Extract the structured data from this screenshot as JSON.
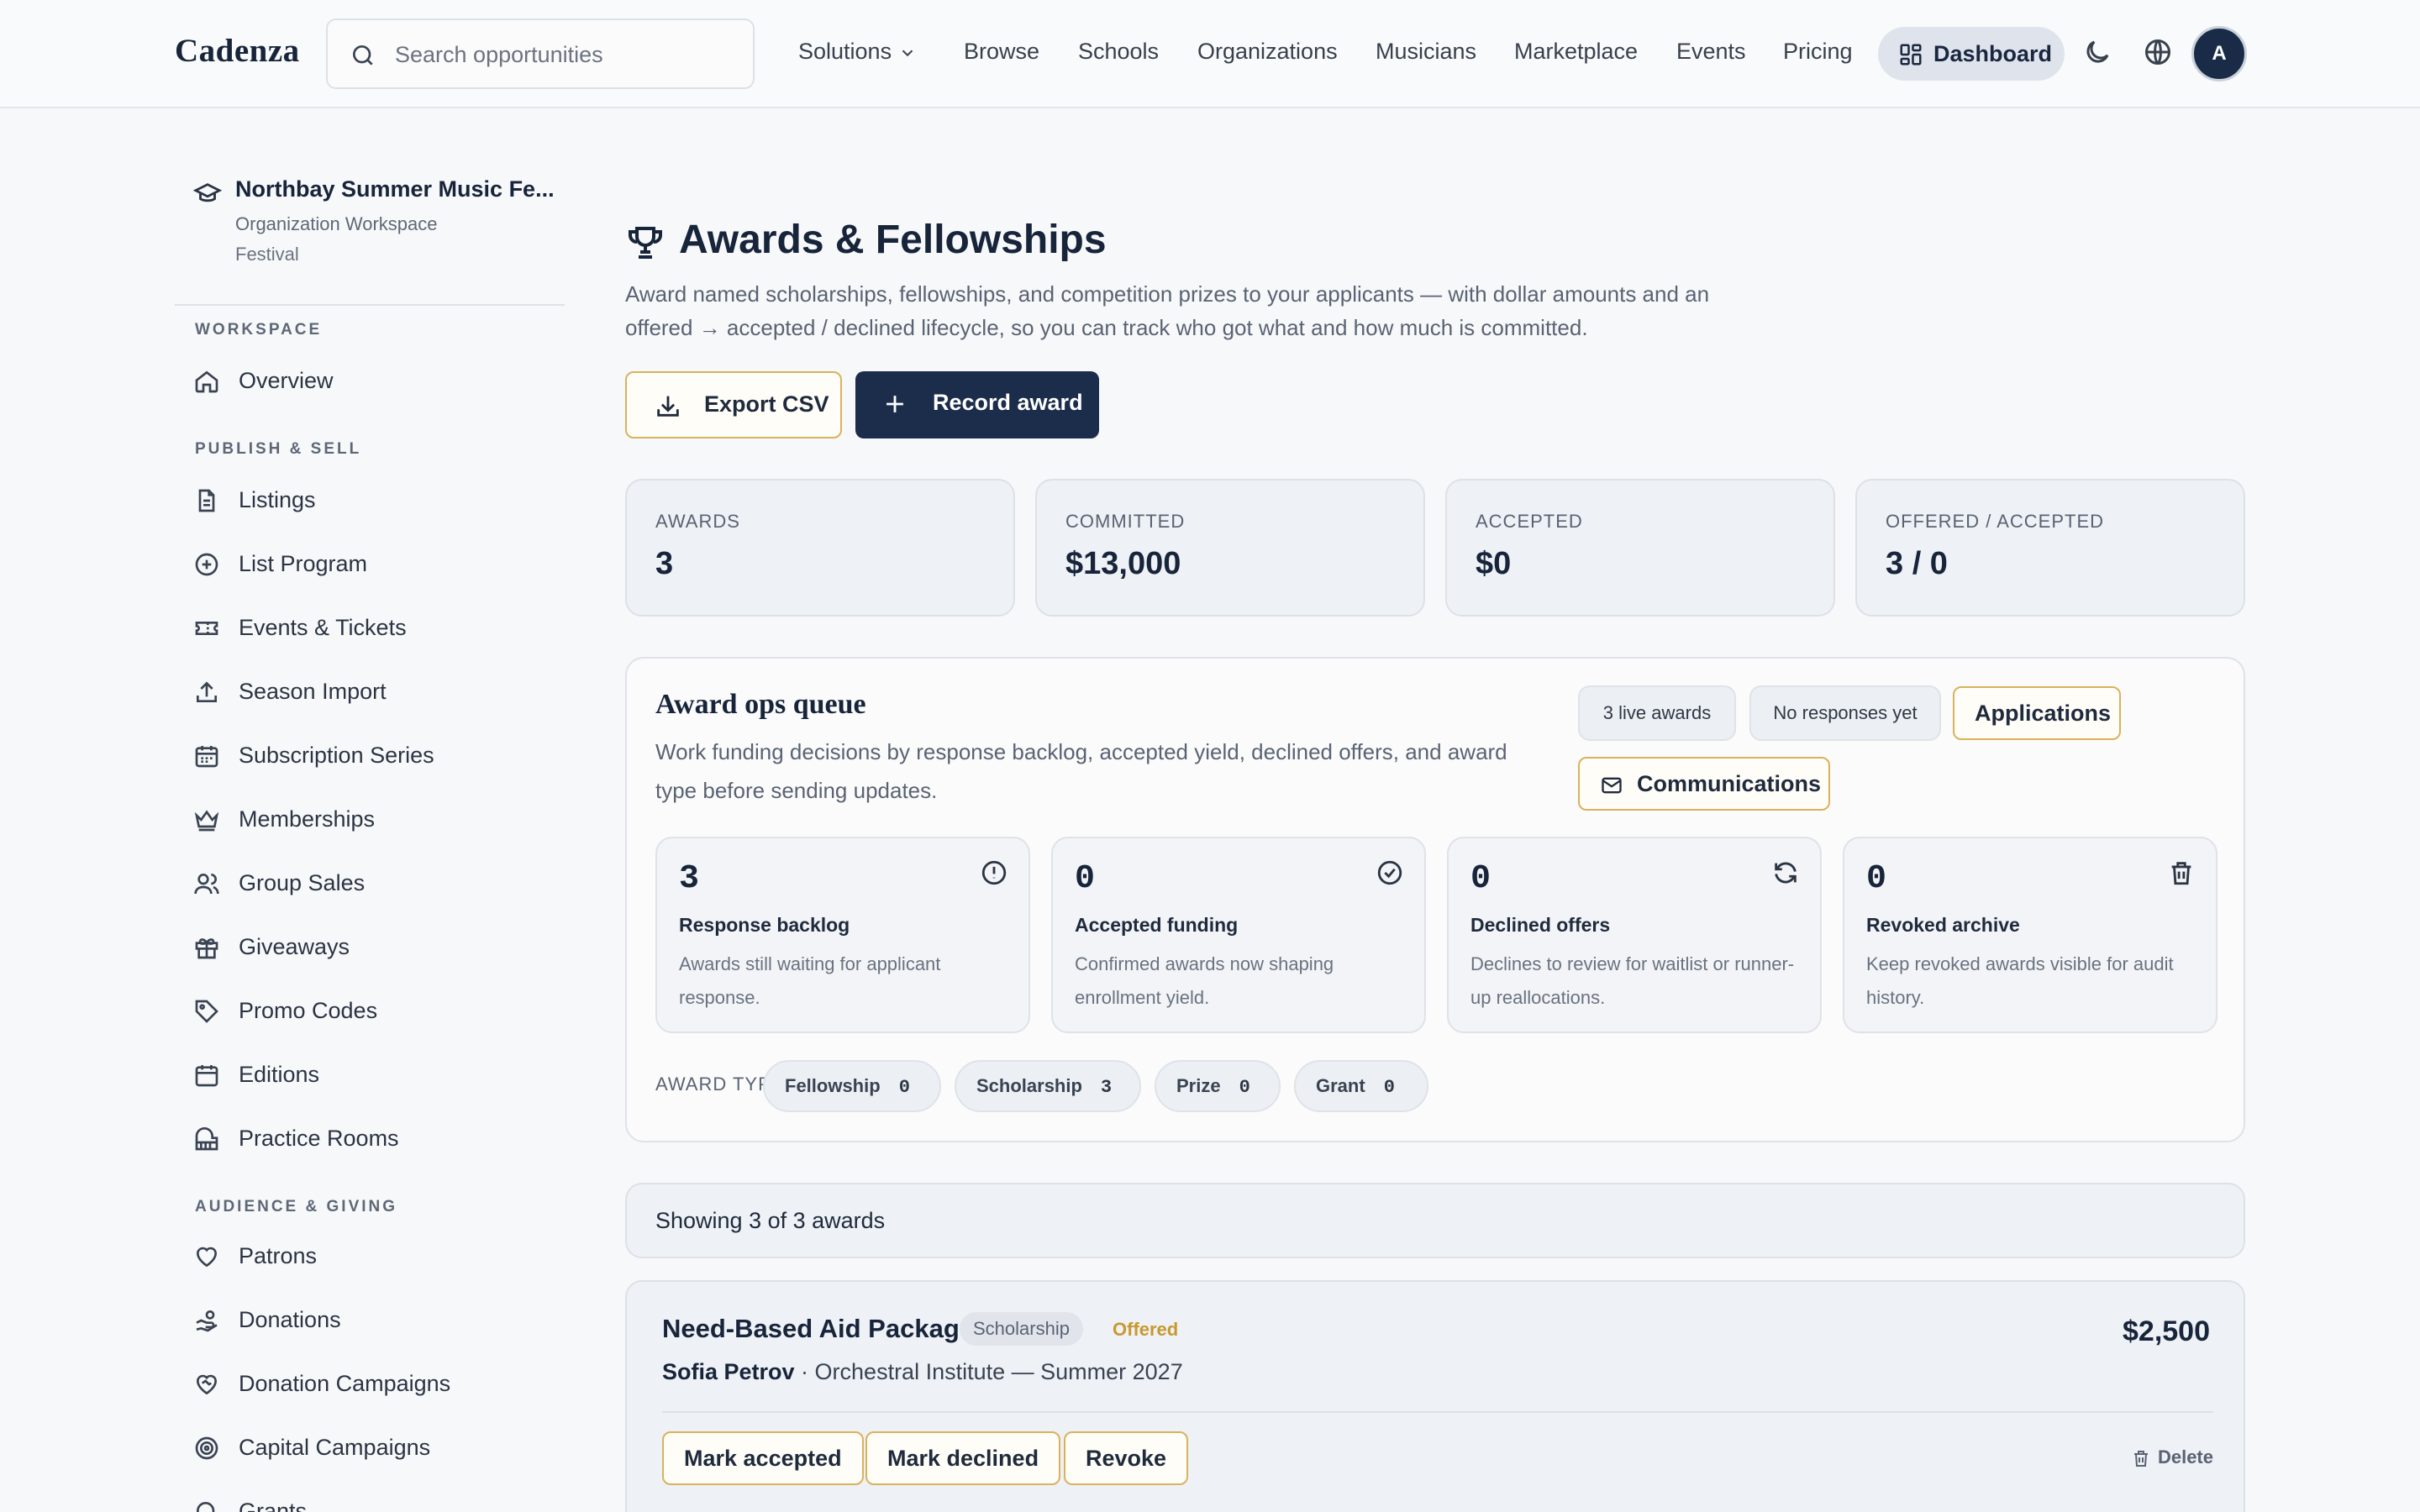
{
  "app": {
    "brand": "Cadenza"
  },
  "header": {
    "search_placeholder": "Search opportunities",
    "nav": [
      "Solutions",
      "Browse",
      "Schools",
      "Organizations",
      "Musicians",
      "Marketplace",
      "Events",
      "Pricing"
    ],
    "dashboard_label": "Dashboard",
    "avatar_initial": "A"
  },
  "workspace": {
    "name": "Northbay Summer Music Fe...",
    "subtitle": "Organization Workspace",
    "type": "Festival"
  },
  "sidebar": {
    "sections": [
      "WORKSPACE",
      "PUBLISH & SELL",
      "AUDIENCE & GIVING"
    ],
    "items": [
      {
        "label": "Overview",
        "icon": "home-icon"
      },
      {
        "label": "Listings",
        "icon": "document-icon"
      },
      {
        "label": "List Program",
        "icon": "plus-circle-icon"
      },
      {
        "label": "Events & Tickets",
        "icon": "ticket-icon"
      },
      {
        "label": "Season Import",
        "icon": "upload-icon"
      },
      {
        "label": "Subscription Series",
        "icon": "calendar-grid-icon"
      },
      {
        "label": "Memberships",
        "icon": "crown-icon"
      },
      {
        "label": "Group Sales",
        "icon": "users-icon"
      },
      {
        "label": "Giveaways",
        "icon": "gift-icon"
      },
      {
        "label": "Promo Codes",
        "icon": "tag-icon"
      },
      {
        "label": "Editions",
        "icon": "calendar-icon"
      },
      {
        "label": "Practice Rooms",
        "icon": "piano-icon"
      },
      {
        "label": "Patrons",
        "icon": "heart-icon"
      },
      {
        "label": "Donations",
        "icon": "hand-coins-icon"
      },
      {
        "label": "Donation Campaigns",
        "icon": "heart-handshake-icon"
      },
      {
        "label": "Capital Campaigns",
        "icon": "target-icon"
      },
      {
        "label": "Grants",
        "icon": "search-icon"
      }
    ]
  },
  "page": {
    "title": "Awards & Fellowships",
    "description": "Award named scholarships, fellowships, and competition prizes to your applicants — with dollar amounts and an offered → accepted / declined lifecycle, so you can track who got what and how much is committed.",
    "export_label": "Export CSV",
    "record_label": "Record award"
  },
  "stats": [
    {
      "label": "AWARDS",
      "value": "3"
    },
    {
      "label": "COMMITTED",
      "value": "$13,000"
    },
    {
      "label": "ACCEPTED",
      "value": "$0"
    },
    {
      "label": "OFFERED / ACCEPTED",
      "value": "3 / 0"
    }
  ],
  "queue": {
    "title": "Award ops queue",
    "description": "Work funding decisions by response backlog, accepted yield, declined offers, and award type before sending updates.",
    "chips": [
      "3 live awards",
      "No responses yet"
    ],
    "applications_label": "Applications",
    "communications_label": "Communications",
    "metrics": [
      {
        "value": "3",
        "title": "Response backlog",
        "desc": "Awards still waiting for applicant response.",
        "icon": "alert-circle-icon"
      },
      {
        "value": "0",
        "title": "Accepted funding",
        "desc": "Confirmed awards now shaping enrollment yield.",
        "icon": "check-circle-icon"
      },
      {
        "value": "0",
        "title": "Declined offers",
        "desc": "Declines to review for waitlist or runner-up reallocations.",
        "icon": "refresh-icon"
      },
      {
        "value": "0",
        "title": "Revoked archive",
        "desc": "Keep revoked awards visible for audit history.",
        "icon": "trash-icon"
      }
    ],
    "type_label": "AWARD TYPE",
    "types": [
      {
        "name": "Fellowship",
        "count": "0"
      },
      {
        "name": "Scholarship",
        "count": "3"
      },
      {
        "name": "Prize",
        "count": "0"
      },
      {
        "name": "Grant",
        "count": "0"
      }
    ]
  },
  "list": {
    "showing": "Showing 3 of 3 awards",
    "awards": [
      {
        "name": "Need-Based Aid Package",
        "type": "Scholarship",
        "status": "Offered",
        "amount": "$2,500",
        "recipient": "Sofia Petrov",
        "program": " · Orchestral Institute — Summer 2027",
        "actions": [
          "Mark accepted",
          "Mark declined",
          "Revoke"
        ],
        "delete_label": "Delete"
      }
    ]
  },
  "colors": {
    "primary": "#1b2d4b",
    "accent_gold": "#d9b25c",
    "status_offered": "#c9992f"
  }
}
